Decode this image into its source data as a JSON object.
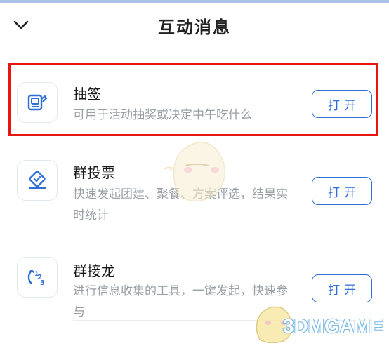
{
  "header": {
    "title": "互动消息",
    "back_icon": "chevron-down-icon"
  },
  "items": [
    {
      "title": "抽签",
      "desc": "可用于活动抽奖或决定中午吃什么",
      "button": "打开",
      "icon": "draw-lots-icon"
    },
    {
      "title": "群投票",
      "desc": "快速发起团建、聚餐、方案评选，结果实时统计",
      "button": "打开",
      "icon": "vote-icon"
    },
    {
      "title": "群接龙",
      "desc": "进行信息收集的工具，一键发起，快速参与",
      "button": "打开",
      "icon": "relay-123-icon"
    }
  ],
  "watermark": {
    "text": "3DMGAME"
  },
  "colors": {
    "accent": "#2f6ed7",
    "highlight": "#e8140f"
  }
}
